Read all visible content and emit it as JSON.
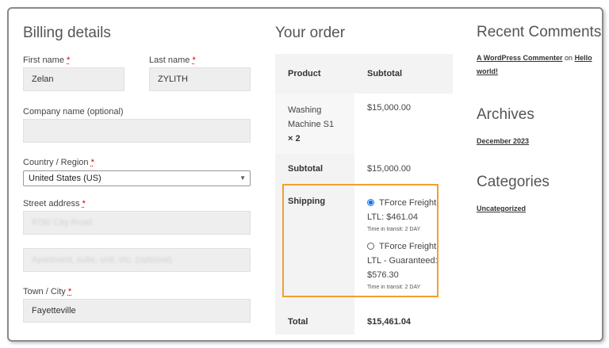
{
  "billing": {
    "title": "Billing details",
    "first_name_label": "First name",
    "last_name_label": "Last name",
    "required_mark": "*",
    "first_name_value": "Zelan",
    "last_name_value": "ZYLITH",
    "company_label": "Company name (optional)",
    "company_value": "",
    "country_label": "Country / Region",
    "country_value": "United States (US)",
    "street_label": "Street address",
    "street_value_blurred": "9780 City Road",
    "street2_placeholder_blurred": "Apartment, suite, unit, etc. (optional)",
    "city_label": "Town / City",
    "city_value": "Fayetteville"
  },
  "order": {
    "title": "Your order",
    "col_product": "Product",
    "col_subtotal": "Subtotal",
    "item_name_line1": "Washing",
    "item_name_line2": "Machine S1",
    "item_qty": "× 2",
    "item_subtotal": "$15,000.00",
    "subtotal_label": "Subtotal",
    "subtotal_value": "$15,000.00",
    "shipping_label": "Shipping",
    "shipping_options": [
      {
        "line1": "TForce Freight",
        "line2": "LTL: $461.04",
        "transit": "Time in transit: 2 DAY",
        "selected": true
      },
      {
        "line1": "TForce Freight",
        "line2": "LTL - Guaranteed:",
        "line3": "$576.30",
        "transit": "Time in transit: 2 DAY",
        "selected": false
      }
    ],
    "total_label": "Total",
    "total_value": "$15,461.04",
    "highlight_color": "#f0a030"
  },
  "sidebar": {
    "recent_comments_title": "Recent Comments",
    "commenter": "A WordPress Commenter",
    "on_text": "on",
    "post_link_line1": "Hello",
    "post_link_line2": "world!",
    "archives_title": "Archives",
    "archive_item": "December 2023",
    "categories_title": "Categories",
    "category_item": "Uncategorized"
  }
}
